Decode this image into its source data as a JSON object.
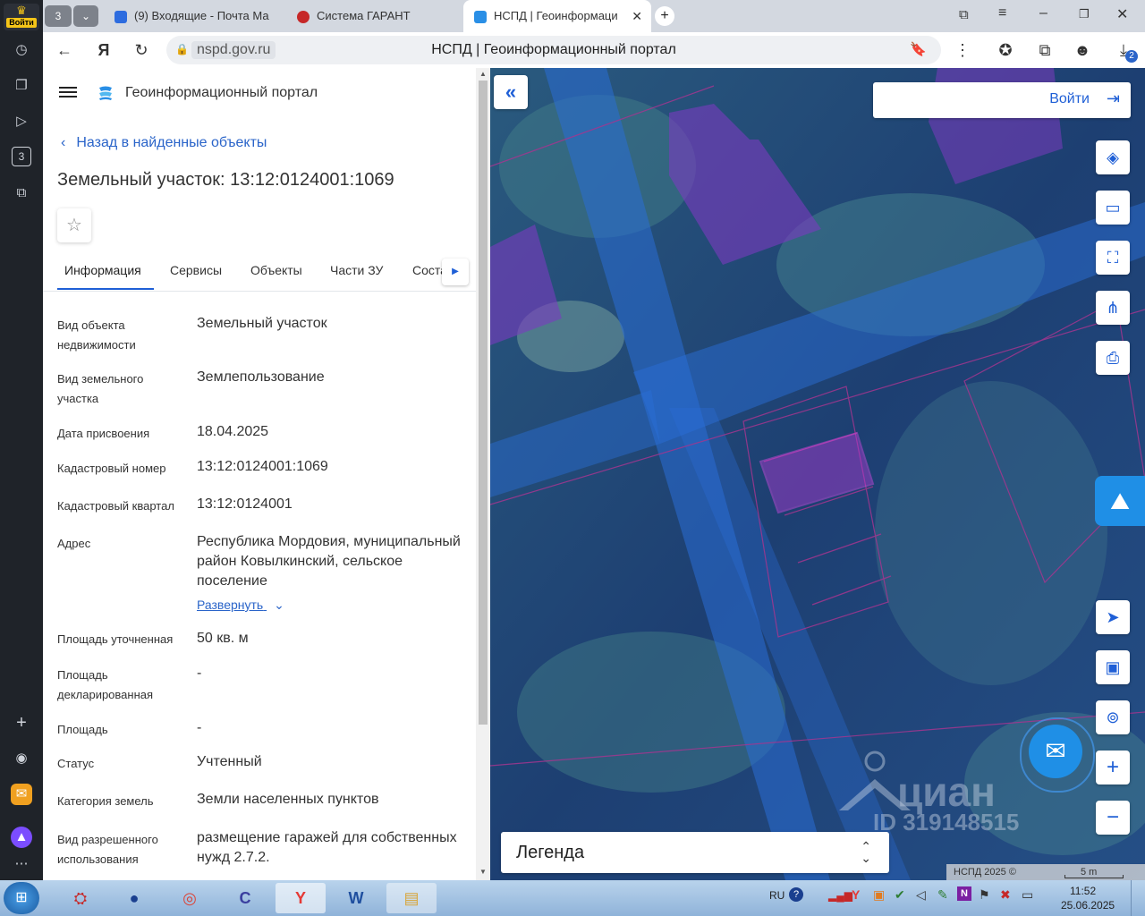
{
  "rail": {
    "login_label": "Войти",
    "tab_count": "3"
  },
  "tabs": [
    {
      "title": "(9) Входящие - Почта Ма"
    },
    {
      "title": "Система ГАРАНТ"
    },
    {
      "title": "НСПД | Геоинформаци"
    }
  ],
  "tab_group_count": "3",
  "address": {
    "host": "nspd.gov.ru",
    "title": "НСПД | Геоинформационный портал",
    "downloads_badge": "2"
  },
  "panel": {
    "portal_title": "Геоинформационный портал",
    "back_link": "Назад в найденные объекты",
    "object_title": "Земельный участок: 13:12:0124001:1069",
    "tabs": [
      "Информация",
      "Сервисы",
      "Объекты",
      "Части ЗУ",
      "Соста"
    ],
    "expand_link": "Развернуть",
    "rows": [
      {
        "label": "Вид объекта недвижимости",
        "value": "Земельный участок"
      },
      {
        "label": "Вид земельного участка",
        "value": "Землепользование"
      },
      {
        "label": "Дата присвоения",
        "value": "18.04.2025"
      },
      {
        "label": "Кадастровый номер",
        "value": "13:12:0124001:1069"
      },
      {
        "label": "Кадастровый квартал",
        "value": "13:12:0124001"
      },
      {
        "label": "Адрес",
        "value": "Республика Мордовия, муниципальный район Ковылкинский, сельское поселение"
      },
      {
        "label": "Площадь уточненная",
        "value": "50 кв. м"
      },
      {
        "label": "Площадь декларированная",
        "value": "-"
      },
      {
        "label": "Площадь",
        "value": "-"
      },
      {
        "label": "Статус",
        "value": "Учтенный"
      },
      {
        "label": "Категория земель",
        "value": "Земли населенных пунктов"
      },
      {
        "label": "Вид разрешенного использования",
        "value": "размещение гаражей для собственных нужд 2.7.2."
      }
    ]
  },
  "map": {
    "login_label": "Войти",
    "legend_label": "Легенда",
    "copyright": "НСПД 2025 ©",
    "scale_label": "5 m",
    "watermark_brand": "циан",
    "watermark_id": "ID 319148515"
  },
  "taskbar": {
    "lang": "RU",
    "time": "11:52",
    "date": "25.06.2025"
  },
  "colors": {
    "accent": "#1f5fd6",
    "link": "#2a64c9",
    "tab_active_underline": "#1f5fd6",
    "parcel": "#b23ad6"
  }
}
